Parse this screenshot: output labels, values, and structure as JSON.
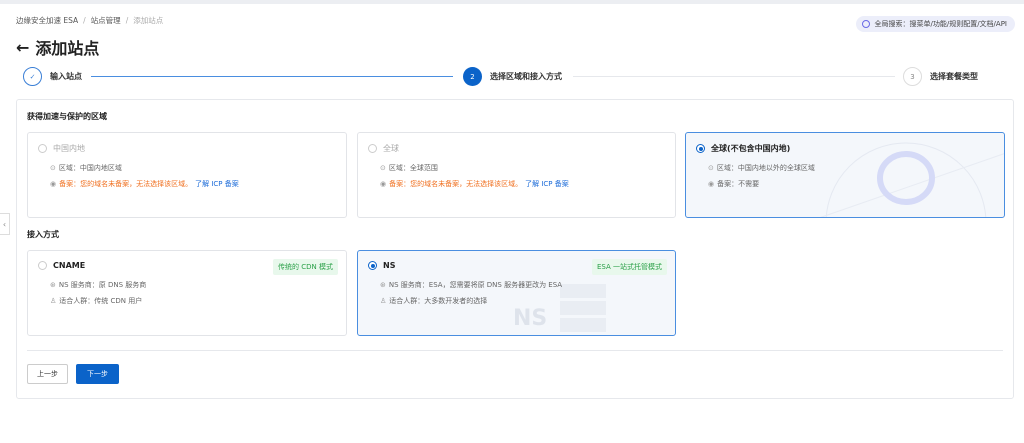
{
  "breadcrumb": [
    "边缘安全加速 ESA",
    "站点管理",
    "添加站点"
  ],
  "global_search": "全局搜索：搜菜单/功能/规则配置/文档/API",
  "page_title": "添加站点",
  "steps": [
    {
      "num": "✓",
      "label": "输入站点"
    },
    {
      "num": "2",
      "label": "选择区域和接入方式"
    },
    {
      "num": "3",
      "label": "选择套餐类型"
    }
  ],
  "region": {
    "title": "获得加速与保护的区域",
    "cards": [
      {
        "name": "中国内地",
        "area": "区域：中国内地区域",
        "icp": "备案：您的域名未备案，无法选择该区域。",
        "link": "了解 ICP 备案",
        "selected": false,
        "disabled": true
      },
      {
        "name": "全球",
        "area": "区域：全球范围",
        "icp": "备案：您的域名未备案，无法选择该区域。",
        "link": "了解 ICP 备案",
        "selected": false,
        "disabled": true
      },
      {
        "name": "全球(不包含中国内地)",
        "area": "区域：中国内地以外的全球区域",
        "icp": "备案：不需要",
        "selected": true,
        "disabled": false
      }
    ]
  },
  "access": {
    "title": "接入方式",
    "cards": [
      {
        "name": "CNAME",
        "tag": "传统的 CDN 模式",
        "ns": "NS 服务商：原 DNS 服务商",
        "users": "适合人群：传统 CDN 用户",
        "selected": false
      },
      {
        "name": "NS",
        "tag": "ESA 一站式托管模式",
        "ns": "NS 服务商：ESA，您需要将原 DNS 服务器更改为 ESA",
        "users": "适合人群：大多数开发者的选择",
        "selected": true,
        "watermark": "NS"
      }
    ]
  },
  "buttons": {
    "prev": "上一步",
    "next": "下一步"
  },
  "colors": {
    "primary": "#0b63c9",
    "warn": "#f07020",
    "tag_green": "#2aa048"
  }
}
